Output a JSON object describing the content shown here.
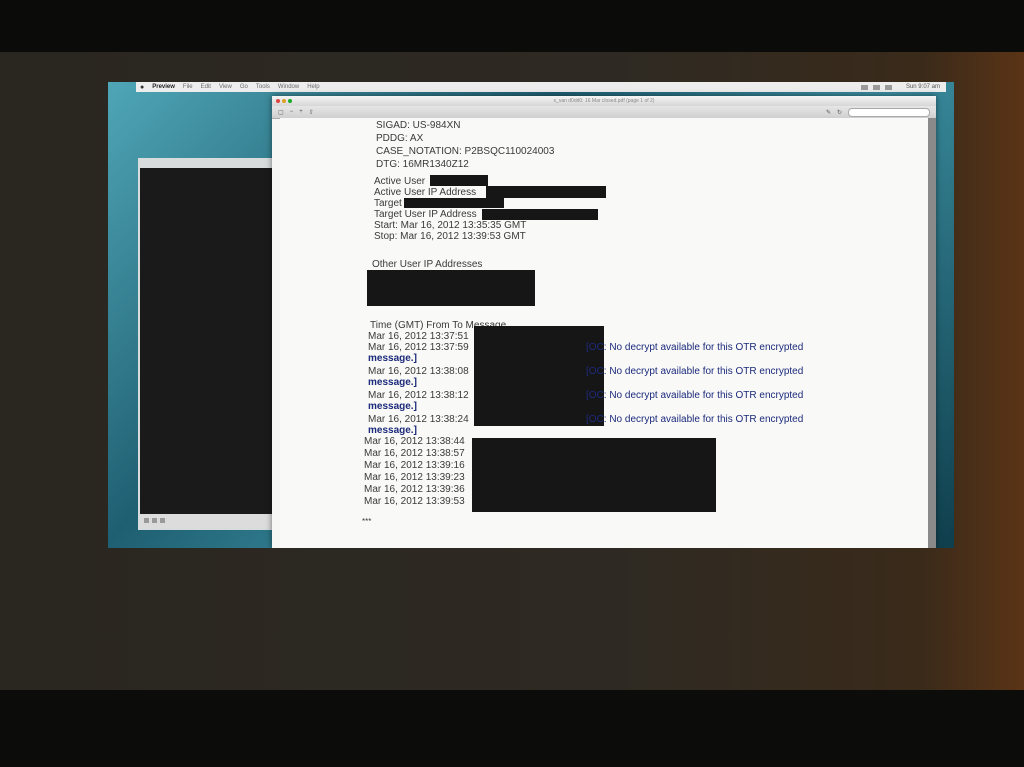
{
  "menubar": {
    "app": "Preview",
    "items": [
      "File",
      "Edit",
      "View",
      "Go",
      "Tools",
      "Window",
      "Help"
    ],
    "clock": "Sun 9:07 am"
  },
  "window": {
    "title": "s_van d0dd0: 16 Mar closed.pdf (page 1 of 2)"
  },
  "header": {
    "sigad": "SIGAD: US-984XN",
    "pddg": "PDDG: AX",
    "case_notation": "CASE_NOTATION: P2BSQC110024003",
    "dtg": "DTG: 16MR1340Z12"
  },
  "session": {
    "active_user": "Active User",
    "active_user_ip": "Active User IP Address",
    "target_user": "Target User",
    "target_user_ip": "Target User IP Address",
    "start": "Start: Mar 16, 2012 13:35:35 GMT",
    "stop": "Stop: Mar 16, 2012 13:39:53 GMT"
  },
  "other_ips_label": "Other User IP Addresses",
  "table": {
    "header": "Time (GMT)  From  To  Message",
    "rows": [
      "Mar 16, 2012 13:37:51",
      "Mar 16, 2012 13:37:59",
      "Mar 16, 2012 13:38:08",
      "Mar 16, 2012 13:38:12",
      "Mar 16, 2012 13:38:24",
      "Mar 16, 2012 13:38:44",
      "Mar 16, 2012 13:38:57",
      "Mar 16, 2012 13:39:16",
      "Mar 16, 2012 13:39:23",
      "Mar 16, 2012 13:39:36",
      "Mar 16, 2012 13:39:53"
    ],
    "otr_message": "[OC: No decrypt available for this OTR encrypted",
    "otr_message_end": "message.]"
  },
  "footer": "***"
}
